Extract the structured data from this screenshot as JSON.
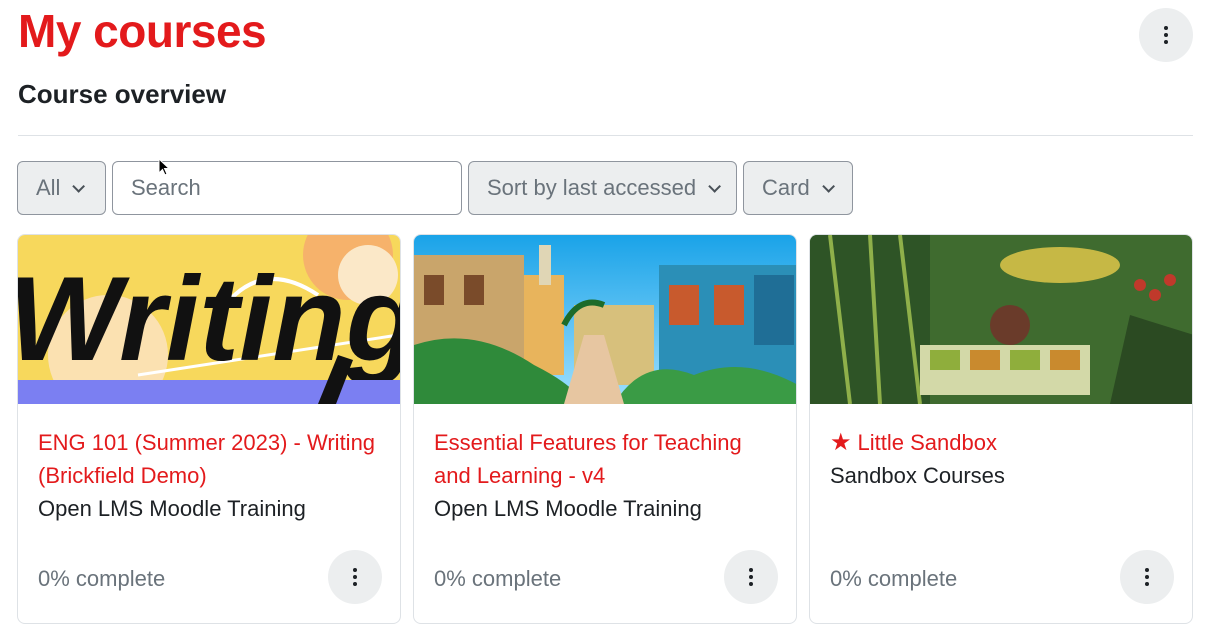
{
  "page": {
    "title": "My courses",
    "section_heading": "Course overview"
  },
  "filters": {
    "grouping": "All",
    "search_placeholder": "Search",
    "sort": "Sort by last accessed",
    "view": "Card"
  },
  "courses": [
    {
      "name": "ENG 101 (Summer 2023) - Writing (Brickfield Demo)",
      "category": "Open LMS Moodle Training",
      "progress": "0% complete",
      "starred": false,
      "image_text": "Writing"
    },
    {
      "name": "Essential Features for Teaching and Learning - v4",
      "category": "Open LMS Moodle Training",
      "progress": "0% complete",
      "starred": false
    },
    {
      "name": "Little Sandbox",
      "category": "Sandbox Courses",
      "progress": "0% complete",
      "starred": true
    }
  ],
  "colors": {
    "accent": "#e31a1c",
    "text": "#1d2125",
    "muted": "#6a737b",
    "button_bg": "#eceeef"
  }
}
